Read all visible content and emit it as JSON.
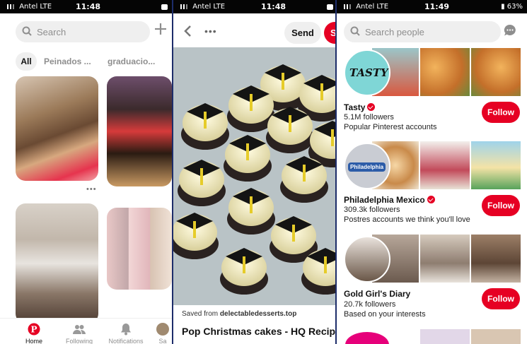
{
  "panel1": {
    "status": {
      "carrier": "Antel LTE",
      "time": "11:48"
    },
    "search": {
      "placeholder": "Search"
    },
    "chips": [
      "All",
      "Peinados ...",
      "graduacio..."
    ],
    "tabs": [
      {
        "label": "Home",
        "icon": "pinterest-logo-icon"
      },
      {
        "label": "Following",
        "icon": "people-icon"
      },
      {
        "label": "Notifications",
        "icon": "bell-icon"
      },
      {
        "label": "Sa",
        "icon": "avatar-icon"
      }
    ]
  },
  "panel2": {
    "status": {
      "carrier": "Antel LTE",
      "time": "11:48"
    },
    "send_label": "Send",
    "save_label": "Sa",
    "saved_from_prefix": "Saved from ",
    "saved_from_domain": "delectabledesserts.top",
    "title": "Pop Christmas cakes - HQ Recipe"
  },
  "panel3": {
    "status": {
      "carrier": "Antel LTE",
      "time": "11:49",
      "battery": "63%"
    },
    "search": {
      "placeholder": "Search people"
    },
    "boards": [
      {
        "name": "Tasty",
        "followers": "5.1M followers",
        "subtitle": "Popular Pinterest accounts",
        "follow_label": "Follow",
        "verified": true
      },
      {
        "name": "Philadelphia Mexico",
        "followers": "309.3k followers",
        "subtitle": "Postres accounts we think you'll love",
        "follow_label": "Follow",
        "verified": true
      },
      {
        "name": "Gold Girl's Diary",
        "followers": "20.7k followers",
        "subtitle": "Based on your interests",
        "follow_label": "Follow",
        "verified": false
      }
    ],
    "tasty_logo": "TASTY",
    "philadelphia_logo": "Philadelphia"
  },
  "colors": {
    "accent": "#e60023",
    "chip_bg": "#efefef",
    "divider": "#1d2d6a"
  }
}
